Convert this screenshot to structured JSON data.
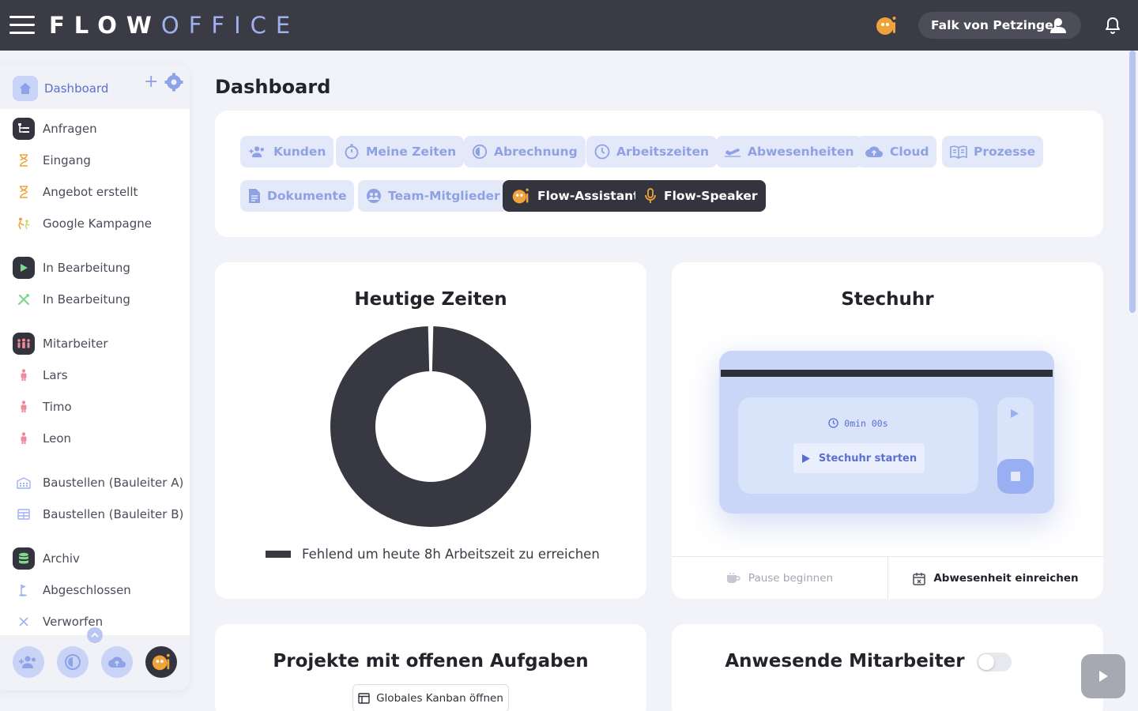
{
  "header": {
    "brand_bold": "FLOW",
    "brand_light": "OFFICE",
    "user_name": "Falk von Petzinger"
  },
  "sidebar": {
    "dashboard_label": "Dashboard",
    "items": [
      {
        "label": "Anfragen",
        "icon": "list-tree-icon"
      },
      {
        "label": "Eingang",
        "icon": "hourglass-icon"
      },
      {
        "label": "Angebot erstellt",
        "icon": "hourglass-icon"
      },
      {
        "label": "Google Kampagne",
        "icon": "people-walking-icon"
      },
      {
        "label": "In Bearbeitung",
        "icon": "play-icon"
      },
      {
        "label": "In Bearbeitung",
        "icon": "tools-icon"
      },
      {
        "label": "Mitarbeiter",
        "icon": "team-icon"
      },
      {
        "label": "Lars",
        "icon": "person-icon"
      },
      {
        "label": "Timo",
        "icon": "person-icon"
      },
      {
        "label": "Leon",
        "icon": "person-icon"
      },
      {
        "label": "Baustellen (Bauleiter A)",
        "icon": "building-icon"
      },
      {
        "label": "Baustellen (Bauleiter B)",
        "icon": "table-icon"
      },
      {
        "label": "Archiv",
        "icon": "database-icon"
      },
      {
        "label": "Abgeschlossen",
        "icon": "golf-flag-icon"
      },
      {
        "label": "Verworfen",
        "icon": "x-icon"
      }
    ]
  },
  "main": {
    "title": "Dashboard",
    "quick_links": [
      {
        "label": "Kunden",
        "icon": "user-plus-icon"
      },
      {
        "label": "Meine Zeiten",
        "icon": "stopwatch-icon"
      },
      {
        "label": "Abrechnung",
        "icon": "moon-clock-icon"
      },
      {
        "label": "Arbeitszeiten",
        "icon": "clock-icon"
      },
      {
        "label": "Abwesenheiten",
        "icon": "plane-icon"
      },
      {
        "label": "Cloud",
        "icon": "cloud-icon"
      },
      {
        "label": "Prozesse",
        "icon": "book-icon"
      },
      {
        "label": "Dokumente",
        "icon": "document-icon"
      },
      {
        "label": "Team-Mitglieder",
        "icon": "globe-team-icon"
      },
      {
        "label": "Flow-Assistant",
        "icon": "assistant-icon"
      },
      {
        "label": "Flow-Speaker",
        "icon": "microphone-icon"
      }
    ],
    "today": {
      "title": "Heutige Zeiten",
      "legend": "Fehlend um heute 8h Arbeitszeit zu erreichen"
    },
    "stechuhr": {
      "title": "Stechuhr",
      "time": "0min 00s",
      "start_label": "Stechuhr starten",
      "pause_label": "Pause beginnen",
      "absence_label": "Abwesenheit einreichen"
    },
    "projects": {
      "title": "Projekte mit offenen Aufgaben",
      "kanban_label": "Globales Kanban öffnen"
    },
    "present": {
      "title": "Anwesende Mitarbeiter",
      "toggle_on": false
    }
  },
  "chart_data": {
    "type": "pie",
    "categories": [
      "Fehlend um heute 8h Arbeitszeit zu erreichen"
    ],
    "values": [
      100
    ],
    "colors": [
      "#373842"
    ]
  },
  "colors": {
    "topbar": "#3a3b45",
    "accent": "#5b6fd1",
    "accent_light": "#e4e9fa",
    "dark_button": "#33343d",
    "assistant_orange": "#f0a23b"
  }
}
